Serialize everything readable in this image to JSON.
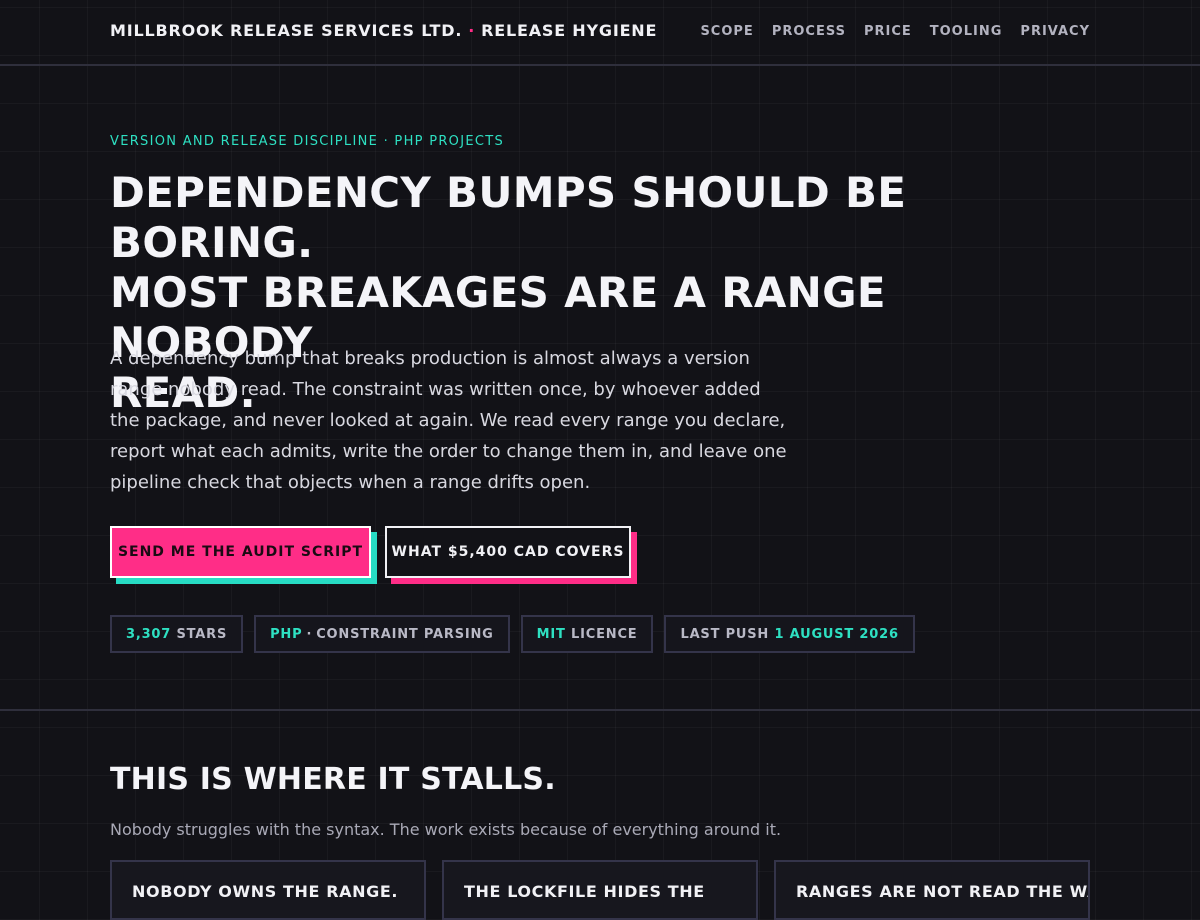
{
  "header": {
    "brand": "MILLBROOK RELEASE SERVICES LTD.",
    "brand_separator": "·",
    "brand_suffix": "RELEASE HYGIENE",
    "nav": [
      "SCOPE",
      "PROCESS",
      "PRICE",
      "TOOLING",
      "PRIVACY"
    ]
  },
  "hero": {
    "eyebrow": "VERSION AND RELEASE DISCIPLINE · PHP PROJECTS",
    "headline_line1": "DEPENDENCY BUMPS SHOULD BE BORING.",
    "headline_line2": "MOST BREAKAGES ARE A RANGE NOBODY",
    "headline_line3": "READ.",
    "lede": "A dependency bump that breaks production is almost always a version range nobody read. The constraint was written once, by whoever added the package, and never looked at again. We read every range you declare, report what each admits, write the order to change them in, and leave one pipeline check that objects when a range drifts open.",
    "primary_cta": "SEND ME THE AUDIT SCRIPT",
    "secondary_cta": "WHAT $5,400 CAD COVERS"
  },
  "badges": {
    "stars_value": "3,307",
    "stars_label": "STARS",
    "lang_value": "PHP",
    "lang_sep": "·",
    "lang_label": "CONSTRAINT PARSING",
    "licence_value": "MIT",
    "licence_label": "LICENCE",
    "push_label": "LAST PUSH",
    "push_value": "1 AUGUST 2026"
  },
  "section": {
    "title": "THIS IS WHERE IT STALLS.",
    "subtitle": "Nobody struggles with the syntax. The work exists because of everything around it.",
    "cards": [
      "NOBODY OWNS THE RANGE.",
      "THE LOCKFILE HIDES THE",
      "RANGES ARE NOT READ THE WAY"
    ]
  },
  "colors": {
    "accent_pink": "#ff2d87",
    "accent_teal": "#2ee0c2",
    "background": "#121217"
  }
}
